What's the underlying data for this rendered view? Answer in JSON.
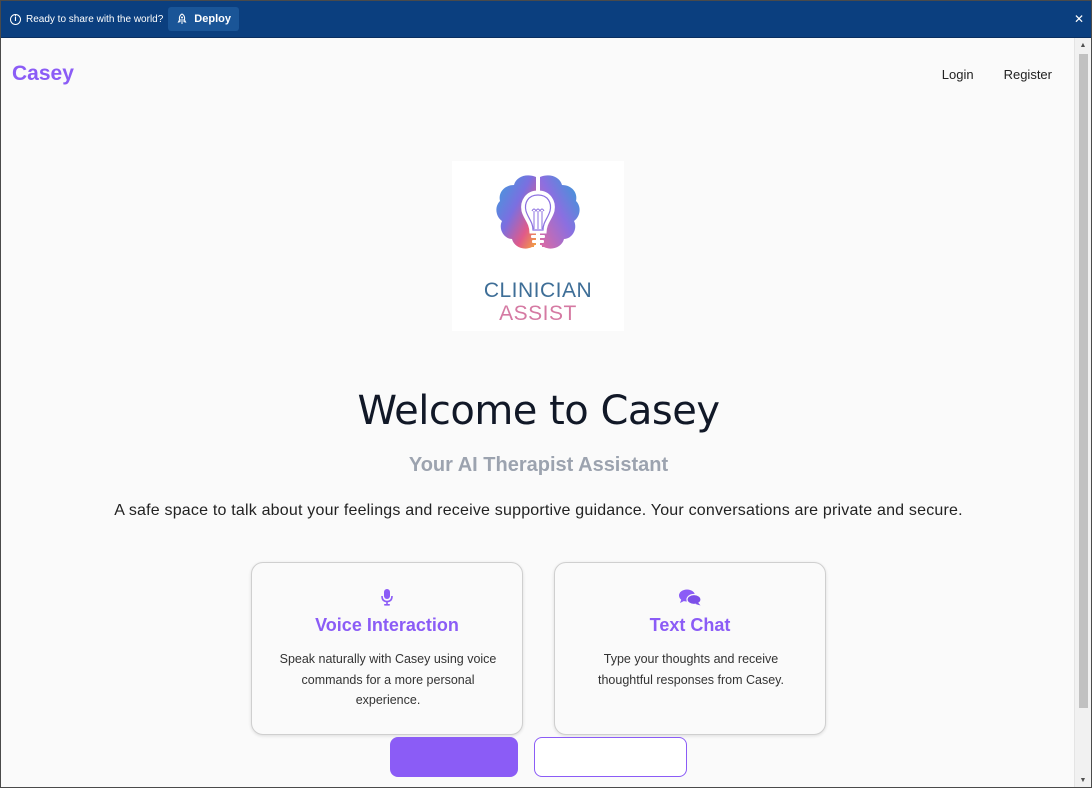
{
  "banner": {
    "message": "Ready to share with the world?",
    "deploy_label": "Deploy",
    "close_symbol": "✕",
    "background_color": "#0b3f7f"
  },
  "header": {
    "brand": "Casey",
    "nav": {
      "login": "Login",
      "register": "Register"
    }
  },
  "logo": {
    "line1": "CLINICIAN",
    "line2": "ASSIST"
  },
  "hero": {
    "title": "Welcome to Casey",
    "subtitle": "Your AI Therapist Assistant",
    "description": "A safe space to talk about your feelings and receive supportive guidance. Your conversations are private and secure."
  },
  "cards": [
    {
      "icon": "microphone-icon",
      "title": "Voice Interaction",
      "text": "Speak naturally with Casey using voice commands for a more personal experience."
    },
    {
      "icon": "chat-bubbles-icon",
      "title": "Text Chat",
      "text": "Type your thoughts and receive thoughtful responses from Casey."
    }
  ],
  "colors": {
    "accent": "#8b5cf6",
    "subtitle": "#9ca3af"
  }
}
